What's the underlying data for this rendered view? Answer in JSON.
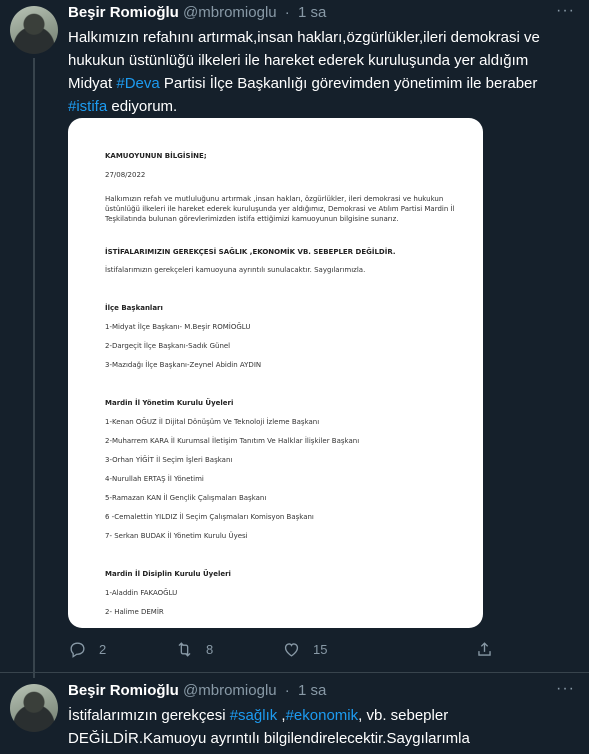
{
  "tweet1": {
    "author_name": "Beşir Romioğlu",
    "author_handle": "@mbromioglu",
    "time": "1 sa",
    "text_parts": [
      {
        "t": "Halkımızın refahını artırmak,insan hakları,özgürlükler,ileri demokrasi ve hukukun üstünlüğü ilkeleri ile hareket ederek kuruluşunda yer aldığım Midyat ",
        "tag": false
      },
      {
        "t": "#Deva",
        "tag": true
      },
      {
        "t": " Partisi İlçe Başkanlığı görevimden yönetimim ile beraber ",
        "tag": false
      },
      {
        "t": "#istifa",
        "tag": true
      },
      {
        "t": " ediyorum.",
        "tag": false
      }
    ],
    "document": {
      "heading": "KAMUOYUNUN BİLGİSİNE;",
      "date": "27/08/2022",
      "paragraph": "Halkımızın refah ve mutluluğunu artırmak ,insan hakları, özgürlükler, ileri demokrasi ve hukukun üstünlüğü ilkeleri ile hareket ederek kuruluşunda yer aldığımız, Demokrasi ve Atılım Partisi Mardin İl Teşkilatında bulunan görevlerimizden istifa ettiğimizi kamuoyunun bilgisine sunarız.",
      "reason": "İSTİFALARIMIZIN GEREKÇESİ SAĞLIK ,EKONOMİK VB. SEBEPLER DEĞİLDİR.",
      "note": "İstifalarımızın gerekçeleri kamuoyuna ayrıntılı sunulacaktır. Saygılarımızla.",
      "section1_title": "İlçe Başkanları",
      "section1_items": [
        "1-Midyat İlçe Başkanı- M.Beşir ROMİOĞLU",
        "2-Dargeçit İlçe Başkanı-Sadık Günel",
        "3-Mazıdağı İlçe Başkanı-Zeynel Abidin AYDIN"
      ],
      "section2_title": "Mardin İl Yönetim Kurulu Üyeleri",
      "section2_items": [
        "1-Kenan OĞUZ İl Dijital Dönüşüm Ve Teknoloji İzleme Başkanı",
        "2-Muharrem KARA İl Kurumsal İletişim Tanıtım Ve Halklar İlişkiler Başkanı",
        "3-Orhan YİĞİT İl Seçim İşleri Başkanı",
        "4-Nurullah ERTAŞ İl Yönetimi",
        "5-Ramazan KAN İl Gençlik Çalışmaları Başkanı",
        "6 -Cemalettin YILDIZ İl Seçim Çalışmaları Komisyon Başkanı",
        "7- Serkan BUDAK İl Yönetim Kurulu Üyesi"
      ],
      "section3_title": "Mardin İl Disiplin Kurulu Üyeleri",
      "section3_items": [
        "1-Aladdin FAKAOĞLU",
        "2- Halime DEMİR"
      ]
    },
    "reply_count": "2",
    "retweet_count": "8",
    "like_count": "15"
  },
  "tweet2": {
    "author_name": "Beşir Romioğlu",
    "author_handle": "@mbromioglu",
    "time": "1 sa",
    "text_parts": [
      {
        "t": "İstifalarımızın gerekçesi ",
        "tag": false
      },
      {
        "t": "#sağlık",
        "tag": true
      },
      {
        "t": " ,",
        "tag": false
      },
      {
        "t": "#ekonomik",
        "tag": true
      },
      {
        "t": ", vb. sebepler DEĞİLDİR.Kamuoyu ayrıntılı bilgilendirelecektir.Saygılarımla",
        "tag": false
      }
    ]
  },
  "colors": {
    "background": "#15202b",
    "hashtag": "#1d9bf0",
    "secondary_text": "#8899a6",
    "divider": "#38444d"
  },
  "icons": {
    "more": "more-dots-icon",
    "reply": "reply-icon",
    "retweet": "retweet-icon",
    "like": "heart-icon",
    "share": "share-icon"
  }
}
